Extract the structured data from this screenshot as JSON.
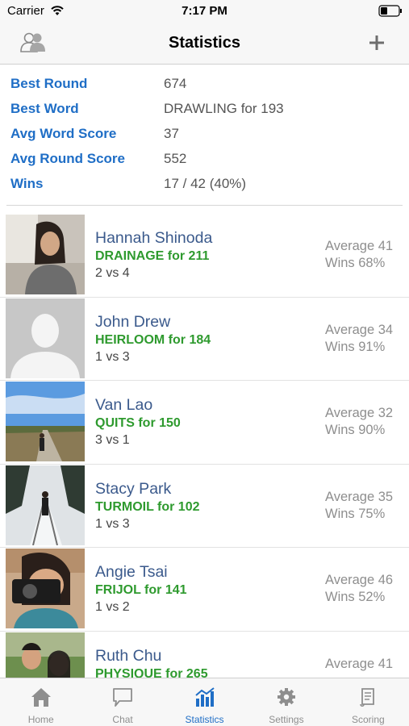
{
  "status": {
    "carrier": "Carrier",
    "time": "7:17 PM"
  },
  "nav": {
    "title": "Statistics"
  },
  "stats": [
    {
      "label": "Best Round",
      "value": "674"
    },
    {
      "label": "Best Word",
      "value": "DRAWLING for 193"
    },
    {
      "label": "Avg Word Score",
      "value": "37"
    },
    {
      "label": "Avg Round Score",
      "value": "552"
    },
    {
      "label": "Wins",
      "value": "17 / 42 (40%)"
    }
  ],
  "players": [
    {
      "name": "Hannah Shinoda",
      "best": "DRAINAGE for 211",
      "record": "2 vs 4",
      "average": "Average 41",
      "wins": "Wins 68%"
    },
    {
      "name": "John Drew",
      "best": "HEIRLOOM for 184",
      "record": "1 vs 3",
      "average": "Average 34",
      "wins": "Wins 91%"
    },
    {
      "name": "Van Lao",
      "best": "QUITS for 150",
      "record": "3 vs 1",
      "average": "Average 32",
      "wins": "Wins 90%"
    },
    {
      "name": "Stacy Park",
      "best": "TURMOIL for 102",
      "record": "1 vs 3",
      "average": "Average 35",
      "wins": "Wins 75%"
    },
    {
      "name": "Angie Tsai",
      "best": "FRIJOL for 141",
      "record": "1 vs 2",
      "average": "Average 46",
      "wins": "Wins 52%"
    },
    {
      "name": "Ruth Chu",
      "best": "PHYSIQUE for 265",
      "record": "",
      "average": "Average 41",
      "wins": ""
    }
  ],
  "tabs": [
    {
      "label": "Home",
      "icon": "home-icon"
    },
    {
      "label": "Chat",
      "icon": "chat-icon"
    },
    {
      "label": "Statistics",
      "icon": "statistics-icon",
      "active": true
    },
    {
      "label": "Settings",
      "icon": "gear-icon"
    },
    {
      "label": "Scoring",
      "icon": "scroll-icon"
    }
  ],
  "colors": {
    "accent": "#1f6ec6",
    "word_green": "#2e9a2e",
    "name_blue": "#3b5a8c",
    "muted": "#8e8e8e"
  }
}
